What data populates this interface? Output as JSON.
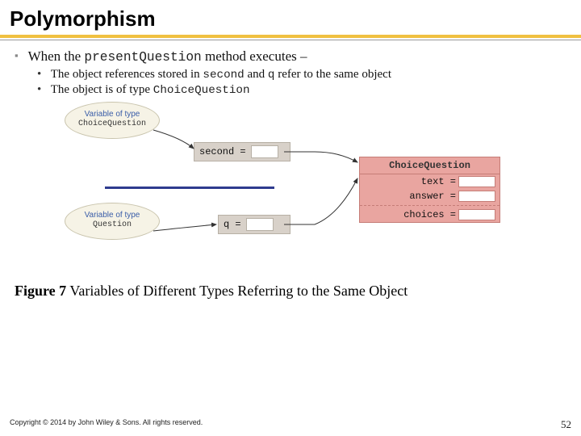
{
  "title": "Polymorphism",
  "bullets": {
    "line1_a": "When the ",
    "line1_code": "presentQuestion",
    "line1_b": " method executes –",
    "sub1_a": "The object references stored in ",
    "sub1_code1": "second",
    "sub1_b": " and ",
    "sub1_code2": "q",
    "sub1_c": " refer to the same object",
    "sub2_a": "The object is of type ",
    "sub2_code": "ChoiceQuestion"
  },
  "diagram": {
    "bubble1_line1": "Variable of type",
    "bubble1_line2": "ChoiceQuestion",
    "bubble2_line1": "Variable of type",
    "bubble2_line2": "Question",
    "var1": "second =",
    "var2": "q =",
    "obj_header": "ChoiceQuestion",
    "field1": "text =",
    "field2": "answer =",
    "field3": "choices ="
  },
  "figure": {
    "num": "Figure 7",
    "caption": " Variables of Different Types Referring to the Same Object"
  },
  "footer": {
    "copyright": "Copyright © 2014 by John Wiley & Sons. All rights reserved.",
    "page": "52"
  }
}
